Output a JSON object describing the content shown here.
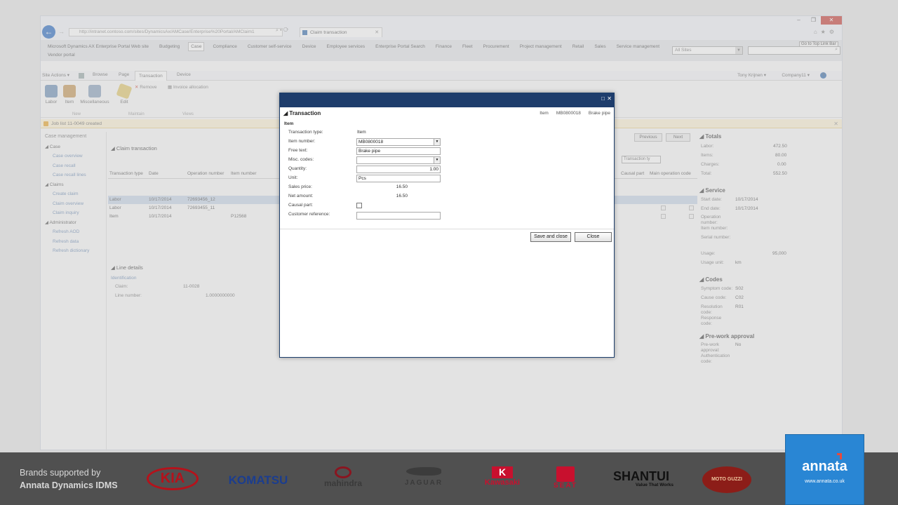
{
  "browser": {
    "address": "http://intranet.contoso.com/sites/DynamicsAx/AMCase/Enterprise%20Portal/AMClaim1",
    "tab_title": "Claim transaction",
    "minimize": "–",
    "maximize": "❐",
    "close": "✕"
  },
  "suitebar": {
    "nav": [
      "Microsoft Dynamics AX Enterprise Portal Web site",
      "Budgeting",
      "Case",
      "Compliance",
      "Customer self-service",
      "Device",
      "Employee services",
      "Enterprise Portal Search",
      "Finance",
      "Fleet",
      "Procurement",
      "Project management",
      "Retail",
      "Sales",
      "Service management"
    ],
    "nav2": "Vendor portal",
    "site_select": "All Sites",
    "toplink": "Go to Top Link Bar"
  },
  "ribbon_tabs": {
    "site_actions": "Site Actions ▾",
    "browse": "Browse",
    "page": "Page",
    "transaction": "Transaction",
    "device": "Device",
    "user": "Tony Krijnen ▾",
    "company": "Company11 ▾",
    "help": "?"
  },
  "ribbon": {
    "labor": "Labor",
    "item": "Item",
    "misc": "Miscellaneous",
    "edit": "Edit",
    "remove": "Remove",
    "invoice": "Invoice allocation",
    "group_new": "New",
    "group_maintain": "Maintain",
    "group_views": "Views"
  },
  "infolog": {
    "text": "Job list 11-0049 created",
    "close": "✕"
  },
  "leftnav": {
    "title": "Case management",
    "case": "◢ Case",
    "case_items": [
      "Case overview",
      "Case recall",
      "Case recall lines"
    ],
    "claims": "◢ Claims",
    "claims_items": [
      "Create claim",
      "Claim overview",
      "Claim inquiry"
    ],
    "admin": "◢ Administrator",
    "admin_items": [
      "Refresh AOD",
      "Refresh data",
      "Refresh dictionary"
    ]
  },
  "center": {
    "section_title": "◢ Claim transaction",
    "previous": "Previous",
    "next": "Next",
    "transaction_type": "Transaction ty",
    "columns": [
      "Transaction type",
      "Date",
      "Operation number",
      "Item number",
      "Causal part",
      "Main operation code"
    ],
    "rows": [
      {
        "type": "Labor",
        "date": "10/17/2014",
        "op": "72693456_12",
        "item": ""
      },
      {
        "type": "Labor",
        "date": "10/17/2014",
        "op": "72693455_11",
        "item": ""
      },
      {
        "type": "Item",
        "date": "10/17/2014",
        "op": "",
        "item": "P12568"
      }
    ],
    "line_details": "◢ Line details",
    "identification": "Identification",
    "claim_label": "Claim:",
    "claim_value": "11-0028",
    "line_label": "Line number:",
    "line_value": "1.0000000000"
  },
  "factbox": {
    "totals": "◢ Totals",
    "labor": "Labor:",
    "labor_v": "472.50",
    "items": "Items:",
    "items_v": "80.00",
    "charges": "Charges:",
    "charges_v": "0.00",
    "total": "Total:",
    "total_v": "552.50",
    "service": "◢ Service",
    "start": "Start date:",
    "start_v": "10/17/2014",
    "end": "End date:",
    "end_v": "10/17/2014",
    "operation": "Operation number:",
    "itemnum": "Item number:",
    "serial": "Serial number:",
    "usage": "Usage:",
    "usage_v": "95,000",
    "usage_unit": "Usage unit:",
    "usage_unit_v": "km",
    "codes": "◢ Codes",
    "symptom": "Symptom code:",
    "symptom_v": "S02",
    "cause": "Cause code:",
    "cause_v": "C02",
    "resolution": "Resolution code:",
    "resolution_v": "R01",
    "response": "Response code:",
    "prework": "◢ Pre-work approval",
    "prework_approval": "Pre-work approval:",
    "prework_approval_v": "No",
    "auth": "Authentication code:"
  },
  "dialog": {
    "maximize": "□",
    "close": "✕",
    "title": "◢ Transaction",
    "crumbs": [
      "Item",
      "MB0800018",
      "Brake pipe"
    ],
    "group": "Item",
    "transaction_type_label": "Transaction type:",
    "transaction_type_value": "Item",
    "item_number_label": "Item number:",
    "item_number_value": "MB0800018",
    "free_text_label": "Free text:",
    "free_text_value": "Brake pipe",
    "misc_codes_label": "Misc. codes:",
    "misc_codes_value": "",
    "quantity_label": "Quantity:",
    "quantity_value": "1.00",
    "unit_label": "Unit:",
    "unit_value": "Pcs",
    "sales_price_label": "Sales price:",
    "sales_price_value": "16.50",
    "net_amount_label": "Net amount:",
    "net_amount_value": "16.50",
    "causal_part_label": "Causal part:",
    "causal_part_checked": false,
    "customer_ref_label": "Customer reference:",
    "customer_ref_value": "",
    "save_close": "Save and close",
    "close_btn": "Close"
  },
  "footer": {
    "line1": "Brands supported by",
    "line2": "Annata Dynamics IDMS",
    "brands": [
      "KIA",
      "KOMATSU",
      "mahindra",
      "JAGUAR",
      "Kawasaki",
      "SEAT",
      "SHANTUI",
      "Value That Works",
      "MOTO GUZZI"
    ],
    "annata": "annata",
    "annata_url": "www.annata.co.uk"
  }
}
